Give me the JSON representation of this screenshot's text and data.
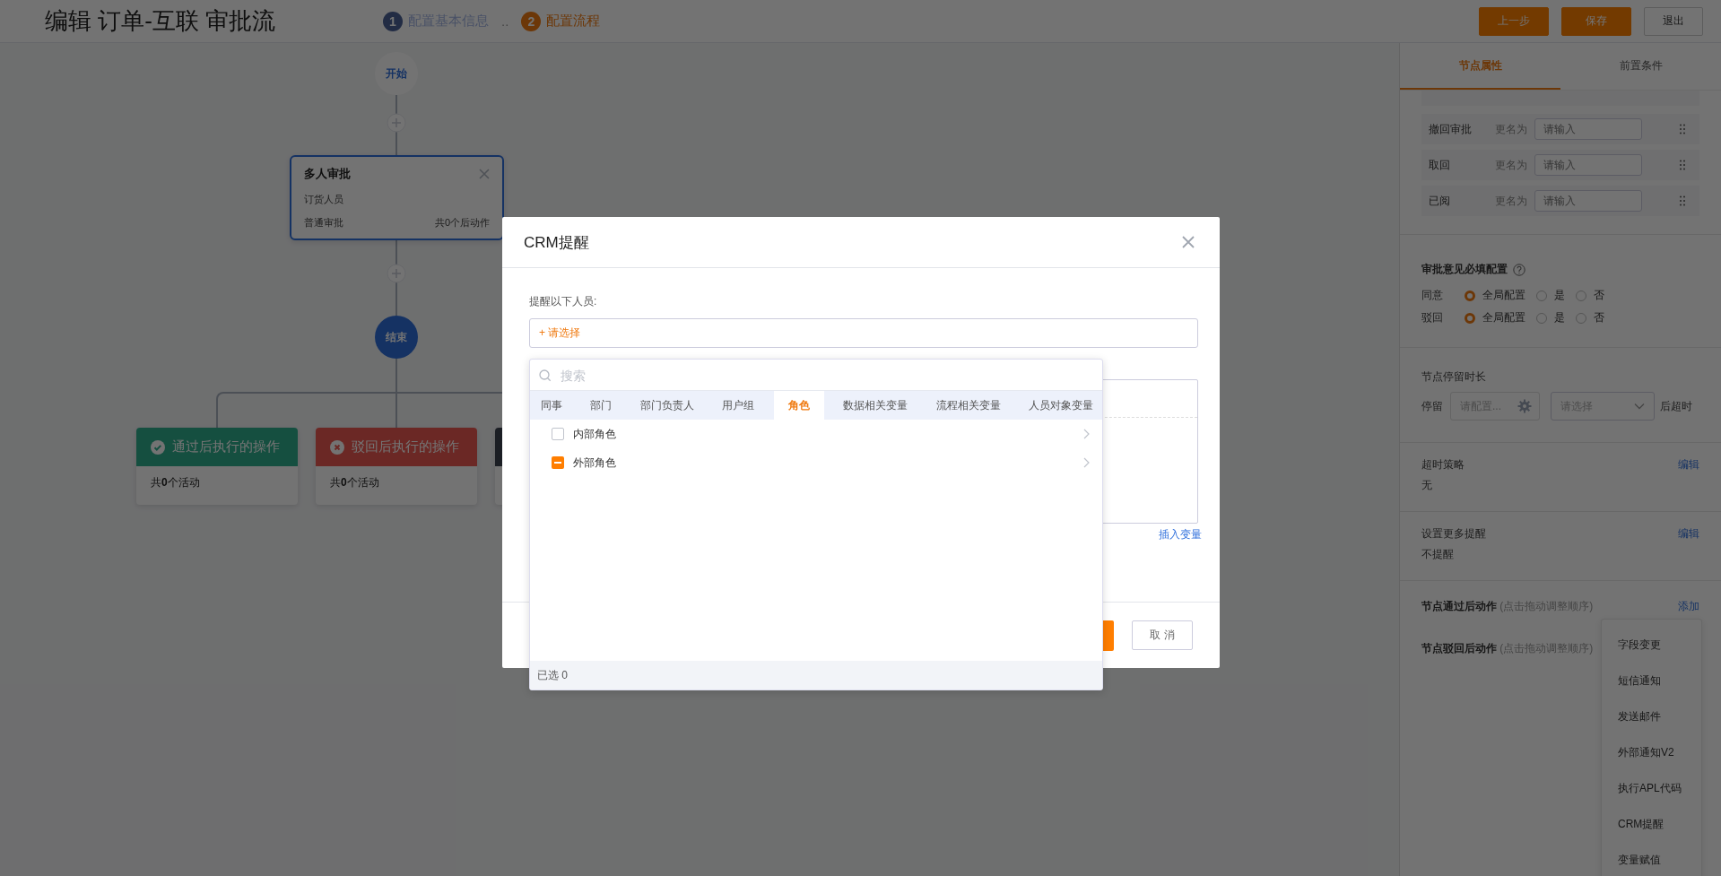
{
  "header": {
    "title": "编辑 订单-互联 审批流",
    "steps": [
      {
        "number": "1",
        "label": "配置基本信息",
        "active": false
      },
      {
        "number": "2",
        "label": "配置流程",
        "active": true
      }
    ],
    "step_separator": "..",
    "buttons": [
      {
        "label": "上一步",
        "kind": "primary"
      },
      {
        "label": "保存",
        "kind": "primary"
      },
      {
        "label": "退出",
        "kind": "default"
      }
    ]
  },
  "canvas": {
    "start_node": "开始",
    "approval_node": {
      "title": "多人审批",
      "assignee": "订货人员",
      "type": "普通审批",
      "action_count": "共0个后动作"
    },
    "end_node": "结束",
    "branches": [
      {
        "kind": "pass",
        "title": "通过后执行的操作",
        "count": "共**0**个活动"
      },
      {
        "kind": "reject",
        "title": "驳回后执行的操作",
        "count": "共**0**个活动"
      }
    ]
  },
  "side_panel": {
    "tabs": [
      {
        "label": "节点属性",
        "selected": true
      },
      {
        "label": "前置条件",
        "selected": false
      }
    ],
    "rename_rows": [
      {
        "label": "撤回审批",
        "rename": "更名为",
        "placeholder": "请输入"
      },
      {
        "label": "取回",
        "rename": "更名为",
        "placeholder": "请输入"
      },
      {
        "label": "已阅",
        "rename": "更名为",
        "placeholder": "请输入"
      }
    ],
    "opinion": {
      "title": "审批意见必填配置",
      "rows": [
        {
          "label": "同意",
          "options": [
            {
              "label": "全局配置",
              "selected": true
            },
            {
              "label": "是",
              "selected": false
            },
            {
              "label": "否",
              "selected": false
            }
          ]
        },
        {
          "label": "驳回",
          "options": [
            {
              "label": "全局配置",
              "selected": true
            },
            {
              "label": "是",
              "selected": false
            },
            {
              "label": "否",
              "selected": false
            }
          ]
        }
      ]
    },
    "stay": {
      "title": "节点停留时长",
      "label": "停留",
      "config_placeholder": "请配置...",
      "select_placeholder": "请选择",
      "suffix": "后超时"
    },
    "timeout": {
      "title": "超时策略",
      "value": "无",
      "link": "编辑"
    },
    "reminder": {
      "title": "设置更多提醒",
      "value": "不提醒",
      "link": "编辑"
    },
    "pass_actions": {
      "title": "节点通过后动作",
      "hint": "(点击拖动调整顺序)",
      "link": "添加"
    },
    "reject_actions": {
      "title": "节点驳回后动作",
      "hint": "(点击拖动调整顺序)"
    },
    "action_menu": [
      "字段变更",
      "短信通知",
      "发送邮件",
      "外部通知V2",
      "执行APL代码",
      "CRM提醒",
      "变量赋值"
    ]
  },
  "modal": {
    "title": "CRM提醒",
    "recipients_label": "提醒以下人员:",
    "select_prompt": "+ 请选择",
    "insert_variable": "插入变量",
    "cancel": "取 消"
  },
  "picker": {
    "search_placeholder": "搜索",
    "tabs": [
      {
        "label": "同事",
        "selected": false
      },
      {
        "label": "部门",
        "selected": false
      },
      {
        "label": "部门负责人",
        "selected": false
      },
      {
        "label": "用户组",
        "selected": false
      },
      {
        "label": "角色",
        "selected": true
      },
      {
        "label": "数据相关变量",
        "selected": false
      },
      {
        "label": "流程相关变量",
        "selected": false
      },
      {
        "label": "人员对象变量",
        "selected": false
      }
    ],
    "items": [
      {
        "label": "内部角色",
        "checked": false,
        "indeterminate": false
      },
      {
        "label": "外部角色",
        "checked": false,
        "indeterminate": true
      }
    ],
    "footer": "已选 0"
  }
}
